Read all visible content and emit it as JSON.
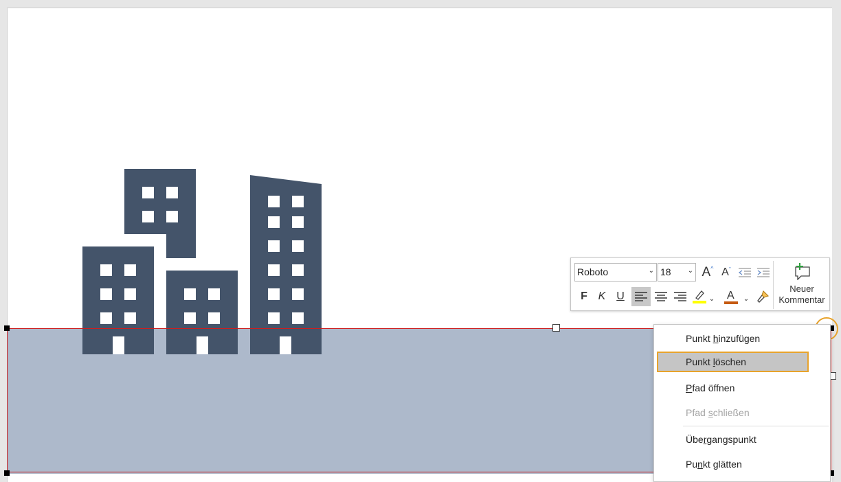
{
  "colors": {
    "building": "#44546a",
    "rectangle_fill": "#adb9cb",
    "edit_outline": "#cc1f1f",
    "highlight": "#e8a32c",
    "font_color_bar": "#c55a11",
    "highlight_color_bar": "#ffff00",
    "comment_icon_plus": "#2e9e3e"
  },
  "mini_toolbar": {
    "font_name": "Roboto",
    "font_size": "18",
    "bold": "F",
    "italic": "K",
    "underline": "U",
    "font_color_letter": "A",
    "increase_font_letter": "A",
    "decrease_font_letter": "A",
    "new_comment_line1": "Neuer",
    "new_comment_line2": "Kommentar",
    "icons": [
      "increase-font-size-icon",
      "decrease-font-size-icon",
      "decrease-indent-icon",
      "increase-indent-icon",
      "align-left-icon",
      "align-center-icon",
      "align-right-icon",
      "highlight-pen-icon",
      "font-color-icon",
      "format-painter-icon",
      "new-comment-icon"
    ]
  },
  "context_menu": {
    "items": [
      {
        "label": "Punkt hinzufügen",
        "accesskey": "h",
        "enabled": true
      },
      {
        "label": "Punkt löschen",
        "accesskey": "l",
        "enabled": true,
        "hovered": true
      },
      {
        "label": "Pfad öffnen",
        "accesskey": "P",
        "enabled": true
      },
      {
        "label": "Pfad schließen",
        "accesskey": "s",
        "enabled": false
      },
      {
        "label": "Übergangspunkt",
        "accesskey": "r",
        "enabled": true
      },
      {
        "label": "Punkt glätten",
        "accesskey": "n",
        "enabled": true
      }
    ]
  }
}
